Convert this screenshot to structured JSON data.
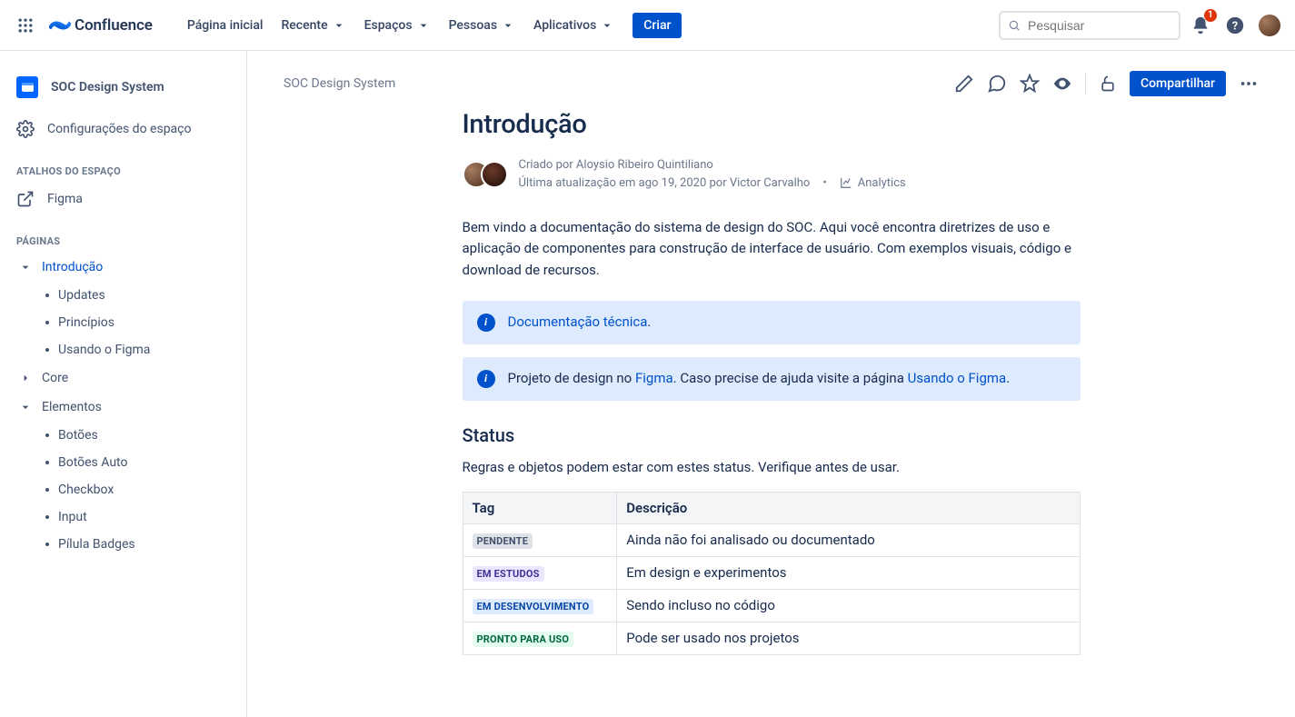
{
  "nav": {
    "logo_text": "Confluence",
    "items": [
      "Página inicial",
      "Recente",
      "Espaços",
      "Pessoas",
      "Aplicativos"
    ],
    "has_chevron": [
      false,
      true,
      true,
      true,
      true
    ],
    "create_label": "Criar",
    "search_placeholder": "Pesquisar",
    "notification_count": "1"
  },
  "sidebar": {
    "space_name": "SOC Design System",
    "settings_label": "Configurações do espaço",
    "section_shortcuts": "Atalhos do espaço",
    "shortcut_figma": "Figma",
    "section_pages": "Páginas",
    "tree": {
      "introducao": {
        "label": "Introdução",
        "children": [
          "Updates",
          "Princípios",
          "Usando o Figma"
        ]
      },
      "core": {
        "label": "Core"
      },
      "elementos": {
        "label": "Elementos",
        "children": [
          "Botões",
          "Botões Auto",
          "Checkbox",
          "Input",
          "Pílula Badges"
        ]
      }
    }
  },
  "page": {
    "breadcrumb": "SOC Design System",
    "share_label": "Compartilhar",
    "title": "Introdução",
    "created_by_prefix": "Criado por ",
    "created_by_name": "Aloysio Ribeiro Quintiliano",
    "updated_prefix": "Última atualização ",
    "updated_date": "em ago 19, 2020",
    "updated_by_prefix": " por ",
    "updated_by_name": "Victor Carvalho",
    "analytics_label": "Analytics",
    "intro_paragraph": "Bem vindo a documentação do sistema de design do SOC. Aqui você encontra diretrizes de uso e aplicação de componentes para construção de interface de usuário. Com exemplos visuais, código e download de recursos.",
    "info1_link": "Documentação técnica",
    "info1_suffix": ".",
    "info2_prefix": "Projeto de design no ",
    "info2_link1": "Figma",
    "info2_mid": ". Caso precise de ajuda visite a página ",
    "info2_link2": "Usando o Figma",
    "info2_suffix": ".",
    "status_heading": "Status",
    "status_sub": "Regras e objetos podem estar com estes status. Verifique antes de usar.",
    "table": {
      "header_tag": "Tag",
      "header_desc": "Descrição",
      "rows": [
        {
          "tag": "PENDENTE",
          "class": "loz-default",
          "desc": " Ainda não foi analisado ou documentado"
        },
        {
          "tag": "EM ESTUDOS",
          "class": "loz-purple",
          "desc": "Em design e experimentos"
        },
        {
          "tag": "EM DESENVOLVIMENTO",
          "class": "loz-blue",
          "desc": "Sendo incluso no código"
        },
        {
          "tag": "PRONTO PARA USO",
          "class": "loz-green",
          "desc": "Pode ser usado nos projetos"
        }
      ]
    }
  }
}
